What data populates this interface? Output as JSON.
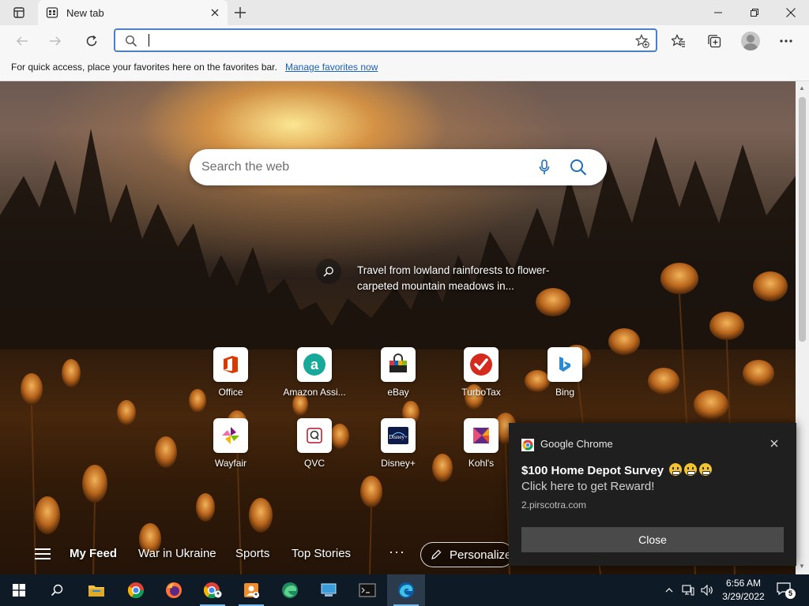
{
  "window": {
    "tab_title": "New tab"
  },
  "address_bar": {
    "value": "",
    "placeholder": ""
  },
  "favorites_bar": {
    "message": "For quick access, place your favorites here on the favorites bar.",
    "link": "Manage favorites now"
  },
  "ntp": {
    "search_placeholder": "Search the web",
    "caption": "Travel from lowland rainforests to flower-carpeted mountain meadows in...",
    "tiles": [
      {
        "label": "Office"
      },
      {
        "label": "Amazon Assi..."
      },
      {
        "label": "eBay"
      },
      {
        "label": "TurboTax"
      },
      {
        "label": "Bing"
      },
      {
        "label": "Wayfair"
      },
      {
        "label": "QVC"
      },
      {
        "label": "Disney+"
      },
      {
        "label": "Kohl's"
      }
    ],
    "feed": {
      "items": [
        "My Feed",
        "War in Ukraine",
        "Sports",
        "Top Stories"
      ],
      "more": "···",
      "personalize": "Personalize"
    }
  },
  "notification": {
    "app": "Google Chrome",
    "title": "$100 Home Depot Survey",
    "body": "Click here to get Reward!",
    "source": "2.pirscotra.com",
    "button": "Close"
  },
  "taskbar": {
    "time": "6:56 AM",
    "date": "3/29/2022",
    "notification_count": "5"
  },
  "colors": {
    "accent": "#4d7fc4",
    "link": "#1a62b4",
    "taskbar": "#0e1a26",
    "toast_bg": "#1f1f1f"
  }
}
